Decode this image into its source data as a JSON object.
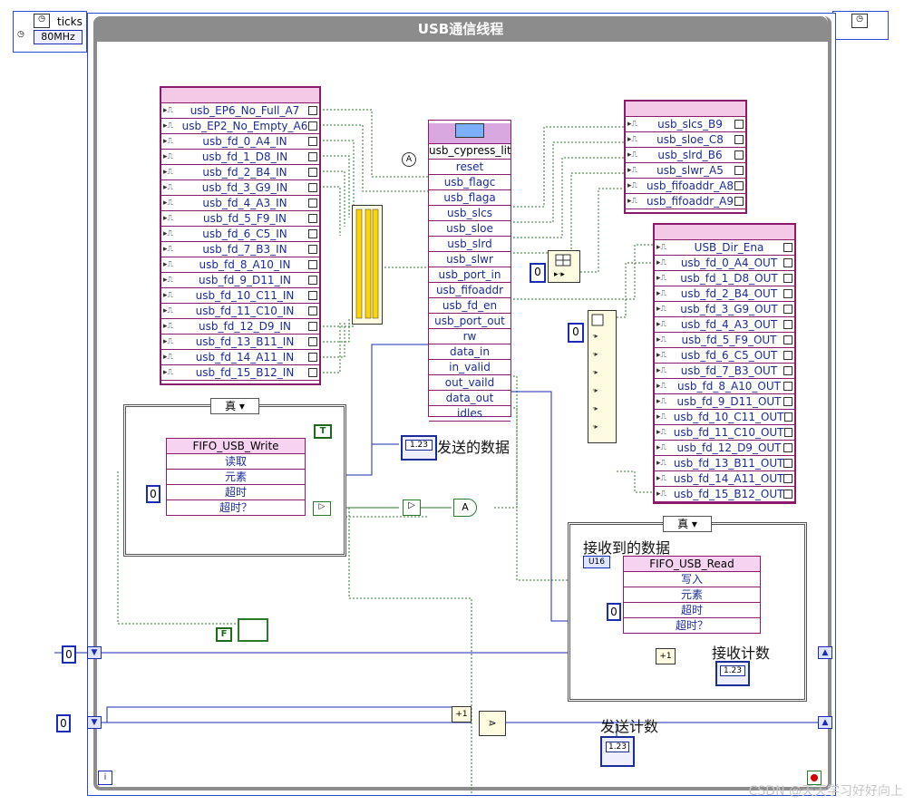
{
  "loop": {
    "title": "USB通信线程",
    "ticks_label": "ticks",
    "ticks_value": "80MHz",
    "info_icon": "i"
  },
  "input_panel": {
    "items": [
      "usb_EP6_No_Full_A7",
      "usb_EP2_No_Empty_A6",
      "usb_fd_0_A4_IN",
      "usb_fd_1_D8_IN",
      "usb_fd_2_B4_IN",
      "usb_fd_3_G9_IN",
      "usb_fd_4_A3_IN",
      "usb_fd_5_F9_IN",
      "usb_fd_6_C5_IN",
      "usb_fd_7_B3_IN",
      "usb_fd_8_A10_IN",
      "usb_fd_9_D11_IN",
      "usb_fd_10_C11_IN",
      "usb_fd_11_C10_IN",
      "usb_fd_12_D9_IN",
      "usb_fd_13_B11_IN",
      "usb_fd_14_A11_IN",
      "usb_fd_15_B12_IN"
    ]
  },
  "subvi": {
    "name": "usb_cypress_little",
    "terminals": [
      "reset",
      "usb_flagc",
      "usb_flaga",
      "usb_slcs",
      "usb_sloe",
      "usb_slrd",
      "usb_slwr",
      "usb_port_in",
      "usb_fifoaddr",
      "usb_fd_en",
      "usb_port_out",
      "rw",
      "data_in",
      "in_valid",
      "out_vaild",
      "data_out",
      "idles"
    ]
  },
  "ctrl_panel": {
    "items": [
      "usb_slcs_B9",
      "usb_sloe_C8",
      "usb_slrd_B6",
      "usb_slwr_A5",
      "usb_fifoaddr_A8",
      "usb_fifoaddr_A9"
    ]
  },
  "output_panel": {
    "items": [
      "USB_Dir_Ena",
      "usb_fd_0_A4_OUT",
      "usb_fd_1_D8_OUT",
      "usb_fd_2_B4_OUT",
      "usb_fd_3_G9_OUT",
      "usb_fd_4_A3_OUT",
      "usb_fd_5_F9_OUT",
      "usb_fd_6_C5_OUT",
      "usb_fd_7_B3_OUT",
      "usb_fd_8_A10_OUT",
      "usb_fd_9_D11_OUT",
      "usb_fd_10_C11_OUT",
      "usb_fd_11_C10_OUT",
      "usb_fd_12_D9_OUT",
      "usb_fd_13_B11_OUT",
      "usb_fd_14_A11_OUT",
      "usb_fd_15_B12_OUT"
    ]
  },
  "case_write": {
    "selector": "真",
    "node_title": "FIFO_USB_Write",
    "rows": [
      "读取",
      "元素",
      "超时",
      "超时？"
    ],
    "timeout_const": "0",
    "true_const": "T"
  },
  "case_read": {
    "selector": "真",
    "node_title": "FIFO_USB_Read",
    "rows": [
      "写入",
      "元素",
      "超时",
      "超时？"
    ],
    "timeout_const": "0",
    "type_tag": "U16",
    "label": "接收到的数据"
  },
  "labels": {
    "send_data": "发送的数据",
    "recv_count": "接收计数",
    "send_count": "发送计数"
  },
  "constants": {
    "addr_const": "0",
    "out_const": "0",
    "loop_const_1": "0",
    "loop_const_2": "0",
    "false_const": "F",
    "reset_const": "A"
  },
  "indicator_value": "1.23",
  "indicator_type": "U32",
  "watermark": "CSDN @天天学习好好向上"
}
